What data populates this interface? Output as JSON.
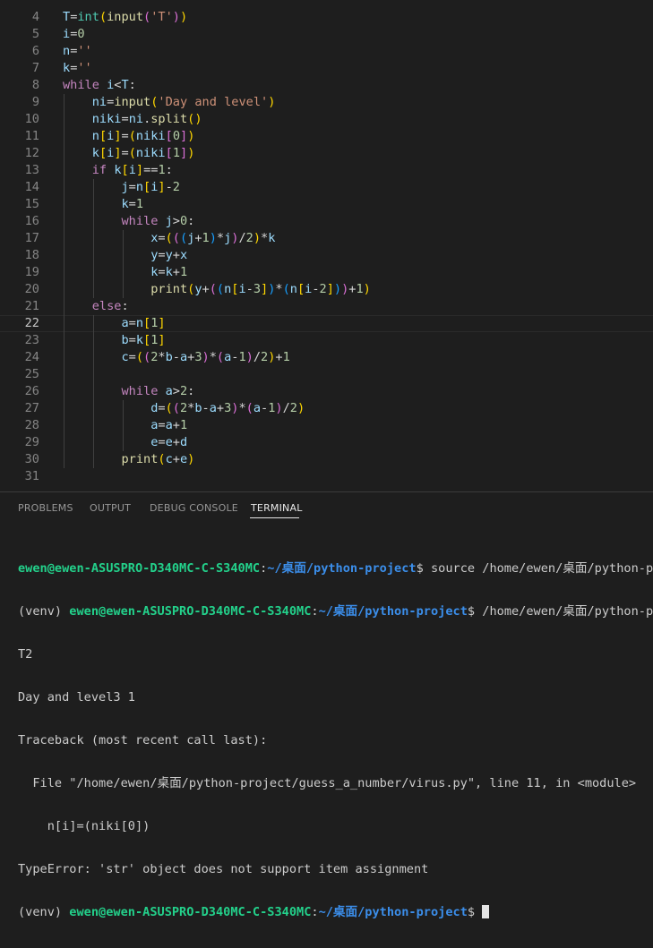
{
  "editor": {
    "lines": [
      {
        "n": "4",
        "text": "T=int(input('T'))"
      },
      {
        "n": "5",
        "text": "i=0"
      },
      {
        "n": "6",
        "text": "n=''"
      },
      {
        "n": "7",
        "text": "k=''"
      },
      {
        "n": "8",
        "text": "while i<T:"
      },
      {
        "n": "9",
        "text": "    ni=input('Day and level')"
      },
      {
        "n": "10",
        "text": "    niki=ni.split()"
      },
      {
        "n": "11",
        "text": "    n[i]=(niki[0])"
      },
      {
        "n": "12",
        "text": "    k[i]=(niki[1])"
      },
      {
        "n": "13",
        "text": "    if k[i]==1:"
      },
      {
        "n": "14",
        "text": "        j=n[i]-2"
      },
      {
        "n": "15",
        "text": "        k=1"
      },
      {
        "n": "16",
        "text": "        while j>0:"
      },
      {
        "n": "17",
        "text": "            x=(((j+1)*j)/2)*k"
      },
      {
        "n": "18",
        "text": "            y=y+x"
      },
      {
        "n": "19",
        "text": "            k=k+1"
      },
      {
        "n": "20",
        "text": "            print(y+((n[i-3])*(n[i-2]))+1)"
      },
      {
        "n": "21",
        "text": "    else:"
      },
      {
        "n": "22",
        "text": "        a=n[1]"
      },
      {
        "n": "23",
        "text": "        b=k[1]"
      },
      {
        "n": "24",
        "text": "        c=((2*b-a+3)*(a-1)/2)+1"
      },
      {
        "n": "25",
        "text": ""
      },
      {
        "n": "26",
        "text": "        while a>2:"
      },
      {
        "n": "27",
        "text": "            d=((2*b-a+3)*(a-1)/2)"
      },
      {
        "n": "28",
        "text": "            a=a+1"
      },
      {
        "n": "29",
        "text": "            e=e+d"
      },
      {
        "n": "30",
        "text": "        print(c+e)"
      },
      {
        "n": "31",
        "text": ""
      }
    ],
    "current_line": "22"
  },
  "panel": {
    "tabs": [
      {
        "label": "PROBLEMS"
      },
      {
        "label": "OUTPUT"
      },
      {
        "label": "DEBUG CONSOLE"
      },
      {
        "label": "TERMINAL"
      }
    ],
    "active_tab": "TERMINAL"
  },
  "terminal": {
    "prompt_user": "ewen@ewen-ASUSPRO-D340MC-C-S340MC",
    "prompt_path": "~/桌面/python-project",
    "venv": "(venv) ",
    "line1_cmd": " source /home/ewen/桌面/python-project/venv/bin/activate",
    "line2_cmd": " /home/ewen/桌面/python-project/venv/bin/python guess_a_number/virus.py",
    "output": [
      "T2",
      "Day and level3 1",
      "Traceback (most recent call last):",
      "  File \"/home/ewen/桌面/python-project/guess_a_number/virus.py\", line 11, in <module>",
      "    n[i]=(niki[0])",
      "TypeError: 'str' object does not support item assignment"
    ]
  },
  "colors": {
    "background": "#1e1e1e",
    "prompt_green": "#23d18b",
    "prompt_blue": "#3b8eea"
  }
}
